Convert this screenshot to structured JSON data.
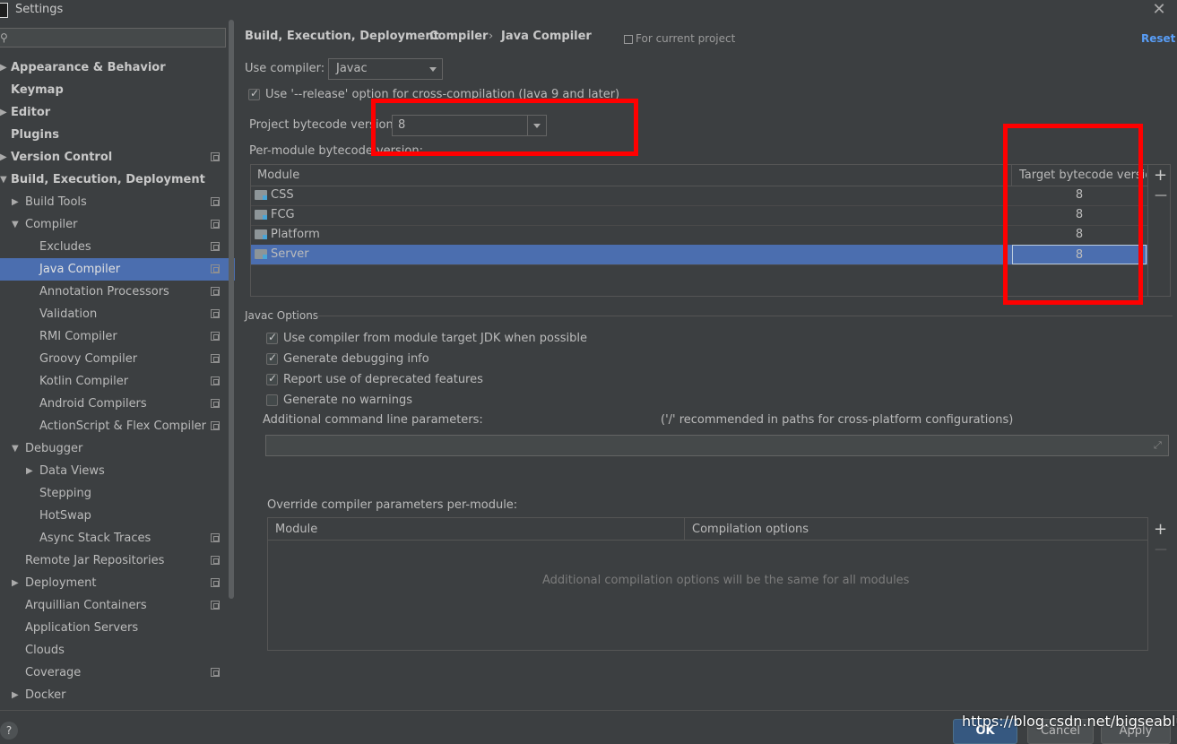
{
  "window": {
    "title": "Settings"
  },
  "sidebar": {
    "search_placeholder": "",
    "items": [
      {
        "label": "Appearance & Behavior"
      },
      {
        "label": "Keymap"
      },
      {
        "label": "Editor"
      },
      {
        "label": "Plugins"
      },
      {
        "label": "Version Control"
      },
      {
        "label": "Build, Execution, Deployment"
      },
      {
        "label": "Build Tools"
      },
      {
        "label": "Compiler"
      },
      {
        "label": "Excludes"
      },
      {
        "label": "Java Compiler"
      },
      {
        "label": "Annotation Processors"
      },
      {
        "label": "Validation"
      },
      {
        "label": "RMI Compiler"
      },
      {
        "label": "Groovy Compiler"
      },
      {
        "label": "Kotlin Compiler"
      },
      {
        "label": "Android Compilers"
      },
      {
        "label": "ActionScript & Flex Compiler"
      },
      {
        "label": "Debugger"
      },
      {
        "label": "Data Views"
      },
      {
        "label": "Stepping"
      },
      {
        "label": "HotSwap"
      },
      {
        "label": "Async Stack Traces"
      },
      {
        "label": "Remote Jar Repositories"
      },
      {
        "label": "Deployment"
      },
      {
        "label": "Arquillian Containers"
      },
      {
        "label": "Application Servers"
      },
      {
        "label": "Clouds"
      },
      {
        "label": "Coverage"
      },
      {
        "label": "Docker"
      }
    ]
  },
  "header": {
    "breadcrumb": [
      "Build, Execution, Deployment",
      "Compiler",
      "Java Compiler"
    ],
    "separator": "›",
    "scope": "For current project",
    "reset": "Reset"
  },
  "compiler": {
    "use_compiler_label": "Use compiler:",
    "use_compiler_value": "Javac",
    "release_option_label": "Use '--release' option for cross-compilation (Java 9 and later)",
    "release_option_checked": true,
    "project_bytecode_label": "Project bytecode version:",
    "project_bytecode_value": "8",
    "per_module_label": "Per-module bytecode version:"
  },
  "module_table": {
    "columns": [
      "Module",
      "Target bytecode version"
    ],
    "rows": [
      {
        "module": "CSS",
        "version": "8"
      },
      {
        "module": "FCG",
        "version": "8"
      },
      {
        "module": "Platform",
        "version": "8"
      },
      {
        "module": "Server",
        "version": "8"
      }
    ],
    "add": "+",
    "remove": "—"
  },
  "javac_options": {
    "section_title": "Javac Options",
    "options": [
      {
        "label": "Use compiler from module target JDK when possible",
        "checked": true
      },
      {
        "label": "Generate debugging info",
        "checked": true
      },
      {
        "label": "Report use of deprecated features",
        "checked": true
      },
      {
        "label": "Generate no warnings",
        "checked": false
      }
    ],
    "additional_params_label": "Additional command line parameters:",
    "additional_params_hint": "('/' recommended in paths for cross-platform configurations)",
    "additional_params_value": "",
    "override_label": "Override compiler parameters per-module:",
    "override_columns": [
      "Module",
      "Compilation options"
    ],
    "override_empty": "Additional compilation options will be the same for all modules",
    "override_add": "+",
    "override_remove": "—"
  },
  "footer": {
    "help": "?",
    "ok": "OK",
    "cancel": "Cancel",
    "apply": "Apply",
    "watermark": "https://blog.csdn.net/bigseabluer"
  },
  "colors": {
    "background": "#3c3f41",
    "selection": "#4b6eaf",
    "link": "#589df6",
    "annotation_red": "#ff0000"
  }
}
